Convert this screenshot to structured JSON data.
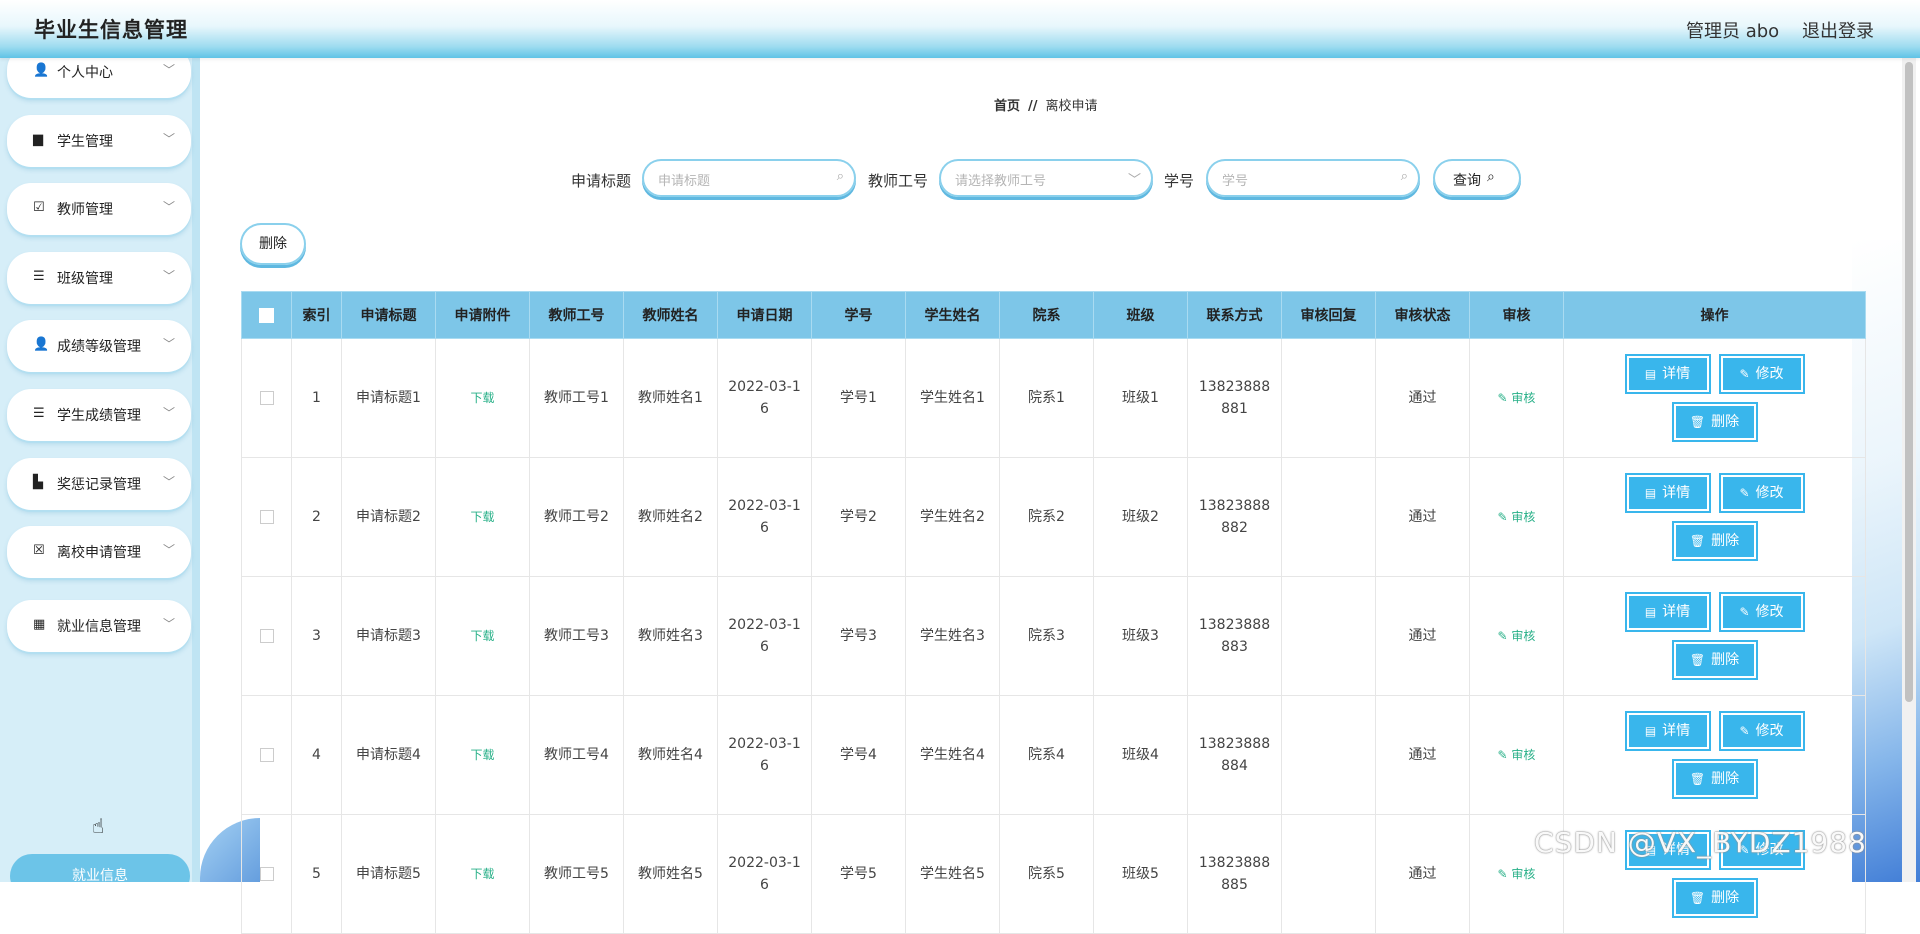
{
  "header": {
    "title": "毕业生信息管理",
    "user": "管理员 abo",
    "logout": "退出登录"
  },
  "sidebar": {
    "items": [
      {
        "label": "个人中心",
        "icon": "person-icon",
        "glyph": "👤"
      },
      {
        "label": "学生管理",
        "icon": "monitor-icon",
        "glyph": "▆"
      },
      {
        "label": "教师管理",
        "icon": "clipboard-check-icon",
        "glyph": "☑"
      },
      {
        "label": "班级管理",
        "icon": "list-icon",
        "glyph": "☰"
      },
      {
        "label": "成绩等级管理",
        "icon": "person-icon",
        "glyph": "👤"
      },
      {
        "label": "学生成绩管理",
        "icon": "list-icon",
        "glyph": "☰"
      },
      {
        "label": "奖惩记录管理",
        "icon": "chart-icon",
        "glyph": "▙"
      },
      {
        "label": "离校申请管理",
        "icon": "clipboard-icon",
        "glyph": "☒"
      },
      {
        "label": "就业信息管理",
        "icon": "grid-icon",
        "glyph": "▦"
      }
    ],
    "arrow": "﹀",
    "sub_item": "就业信息"
  },
  "breadcrumb": {
    "home": "首页",
    "sep": "//",
    "current": "离校申请"
  },
  "search": {
    "title_label": "申请标题",
    "title_placeholder": "申请标题",
    "teacher_label": "教师工号",
    "teacher_placeholder": "请选择教师工号",
    "student_label": "学号",
    "student_placeholder": "学号",
    "query_label": "查询"
  },
  "delete_label": "删除",
  "table": {
    "columns": [
      "索引",
      "申请标题",
      "申请附件",
      "教师工号",
      "教师姓名",
      "申请日期",
      "学号",
      "学生姓名",
      "院系",
      "班级",
      "联系方式",
      "审核回复",
      "审核状态",
      "审核",
      "操作"
    ],
    "rows": [
      {
        "idx": "1",
        "title": "申请标题1",
        "attach": "下载",
        "tno": "教师工号1",
        "tname": "教师姓名1",
        "date1": "2022-03-1",
        "date2": "6",
        "sno": "学号1",
        "sname": "学生姓名1",
        "dept": "院系1",
        "cls": "班级1",
        "phone1": "13823888",
        "phone2": "881",
        "reply": "",
        "status": "通过",
        "audit": "审核"
      },
      {
        "idx": "2",
        "title": "申请标题2",
        "attach": "下载",
        "tno": "教师工号2",
        "tname": "教师姓名2",
        "date1": "2022-03-1",
        "date2": "6",
        "sno": "学号2",
        "sname": "学生姓名2",
        "dept": "院系2",
        "cls": "班级2",
        "phone1": "13823888",
        "phone2": "882",
        "reply": "",
        "status": "通过",
        "audit": "审核"
      },
      {
        "idx": "3",
        "title": "申请标题3",
        "attach": "下载",
        "tno": "教师工号3",
        "tname": "教师姓名3",
        "date1": "2022-03-1",
        "date2": "6",
        "sno": "学号3",
        "sname": "学生姓名3",
        "dept": "院系3",
        "cls": "班级3",
        "phone1": "13823888",
        "phone2": "883",
        "reply": "",
        "status": "通过",
        "audit": "审核"
      },
      {
        "idx": "4",
        "title": "申请标题4",
        "attach": "下载",
        "tno": "教师工号4",
        "tname": "教师姓名4",
        "date1": "2022-03-1",
        "date2": "6",
        "sno": "学号4",
        "sname": "学生姓名4",
        "dept": "院系4",
        "cls": "班级4",
        "phone1": "13823888",
        "phone2": "884",
        "reply": "",
        "status": "通过",
        "audit": "审核"
      },
      {
        "idx": "5",
        "title": "申请标题5",
        "attach": "下载",
        "tno": "教师工号5",
        "tname": "教师姓名5",
        "date1": "2022-03-1",
        "date2": "6",
        "sno": "学号5",
        "sname": "学生姓名5",
        "dept": "院系5",
        "cls": "班级5",
        "phone1": "13823888",
        "phone2": "885",
        "reply": "",
        "status": "通过",
        "audit": "审核"
      }
    ],
    "actions": {
      "detail": "详情",
      "edit": "修改",
      "delete": "删除"
    }
  },
  "watermark": "CSDN @VX_BYDZ1988",
  "colors": {
    "accent": "#39b6ec",
    "header_bg": "#7dc6e8",
    "sidebar_bg": "#d6eef8",
    "link_green": "#28b088"
  }
}
